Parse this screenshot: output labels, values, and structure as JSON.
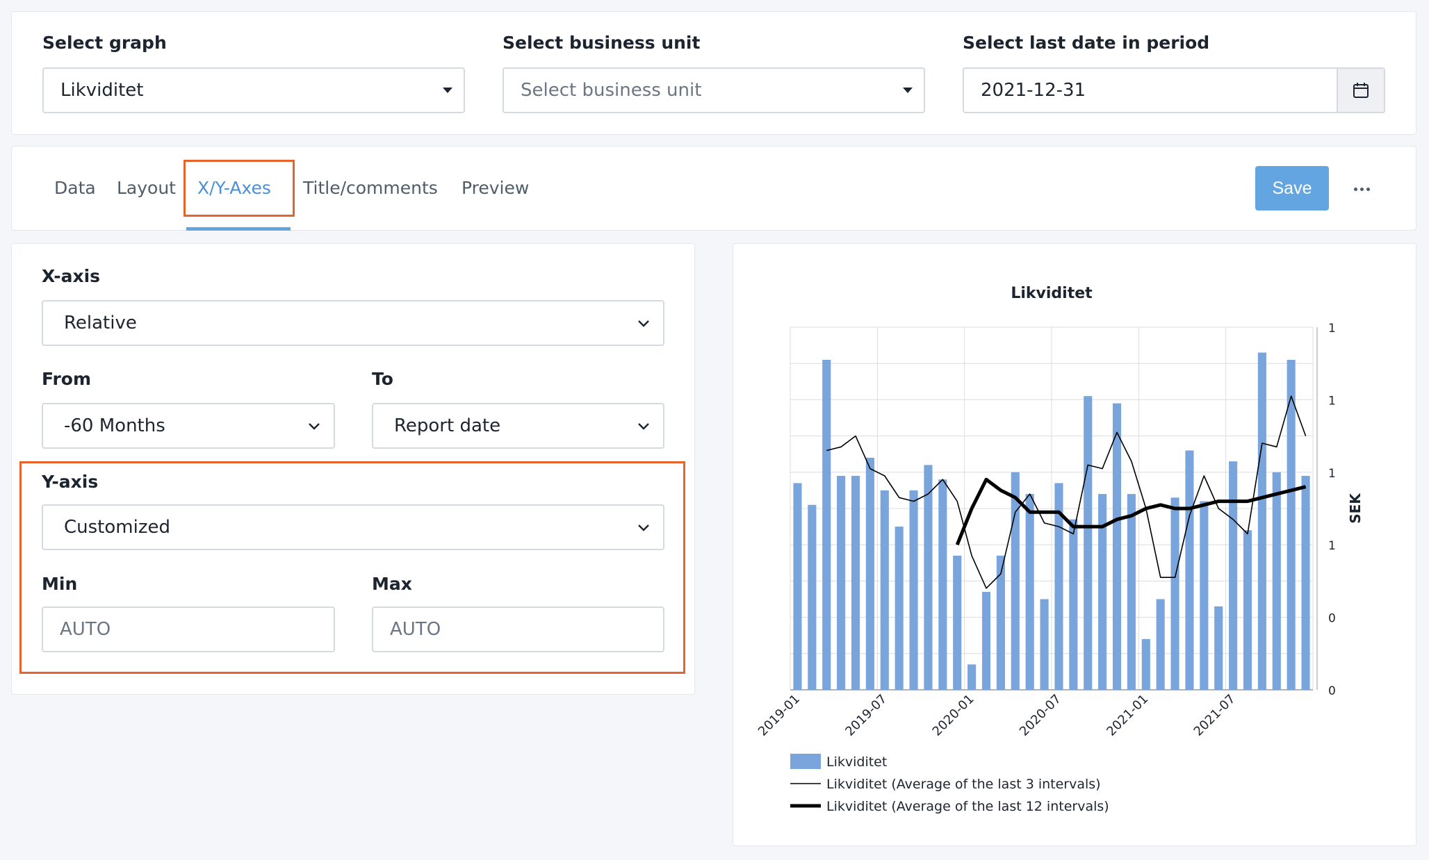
{
  "filters": {
    "graph": {
      "label": "Select graph",
      "value": "Likviditet"
    },
    "business_unit": {
      "label": "Select business unit",
      "placeholder": "Select business unit"
    },
    "last_date": {
      "label": "Select last date in period",
      "value": "2021-12-31"
    }
  },
  "tabs": [
    {
      "label": "Data",
      "active": false
    },
    {
      "label": "Layout",
      "active": false
    },
    {
      "label": "X/Y-Axes",
      "active": true
    },
    {
      "label": "Title/comments",
      "active": false
    },
    {
      "label": "Preview",
      "active": false
    }
  ],
  "toolbar": {
    "save_label": "Save",
    "more_icon": "ellipsis-icon"
  },
  "axes_form": {
    "x_axis": {
      "label": "X-axis",
      "value": "Relative"
    },
    "from": {
      "label": "From",
      "value": "-60 Months"
    },
    "to": {
      "label": "To",
      "value": "Report date"
    },
    "y_axis": {
      "label": "Y-axis",
      "value": "Customized"
    },
    "min": {
      "label": "Min",
      "placeholder": "AUTO"
    },
    "max": {
      "label": "Max",
      "placeholder": "AUTO"
    }
  },
  "colors": {
    "accent": "#4a90d9",
    "highlight": "#e8622c",
    "bar": "#7aa5dc",
    "save": "#62a5e0"
  },
  "chart_data": {
    "type": "bar",
    "title": "Likviditet",
    "ylabel": "SEK",
    "y_tick_labels": [
      "0",
      "0",
      "1",
      "1",
      "1",
      "1"
    ],
    "ylim": [
      0,
      1
    ],
    "x_tick_labels": [
      "2019-01",
      "2019-07",
      "2020-01",
      "2020-07",
      "2021-01",
      "2021-07"
    ],
    "categories": [
      "2019-01",
      "2019-02",
      "2019-03",
      "2019-04",
      "2019-05",
      "2019-06",
      "2019-07",
      "2019-08",
      "2019-09",
      "2019-10",
      "2019-11",
      "2019-12",
      "2020-01",
      "2020-02",
      "2020-03",
      "2020-04",
      "2020-05",
      "2020-06",
      "2020-07",
      "2020-08",
      "2020-09",
      "2020-10",
      "2020-11",
      "2020-12",
      "2021-01",
      "2021-02",
      "2021-03",
      "2021-04",
      "2021-05",
      "2021-06",
      "2021-07",
      "2021-08",
      "2021-09",
      "2021-10",
      "2021-11",
      "2021-12"
    ],
    "series": [
      {
        "name": "Likviditet",
        "kind": "bar",
        "values": [
          0.57,
          0.51,
          0.91,
          0.59,
          0.59,
          0.64,
          0.55,
          0.45,
          0.55,
          0.62,
          0.58,
          0.37,
          0.07,
          0.27,
          0.37,
          0.6,
          0.54,
          0.25,
          0.57,
          0.47,
          0.81,
          0.54,
          0.79,
          0.54,
          0.14,
          0.25,
          0.53,
          0.66,
          0.52,
          0.23,
          0.63,
          0.44,
          0.93,
          0.6,
          0.91,
          0.59
        ]
      },
      {
        "name": "Likviditet (Average of the last 3 intervals)",
        "kind": "line",
        "values": [
          null,
          null,
          0.66,
          0.67,
          0.7,
          0.61,
          0.59,
          0.53,
          0.52,
          0.54,
          0.58,
          0.52,
          0.37,
          0.28,
          0.32,
          0.49,
          0.54,
          0.46,
          0.45,
          0.43,
          0.62,
          0.61,
          0.71,
          0.63,
          0.5,
          0.31,
          0.31,
          0.48,
          0.59,
          0.5,
          0.47,
          0.43,
          0.68,
          0.67,
          0.81,
          0.7
        ]
      },
      {
        "name": "Likviditet (Average of the last 12 intervals)",
        "kind": "line",
        "values": [
          null,
          null,
          null,
          null,
          null,
          null,
          null,
          null,
          null,
          null,
          null,
          0.4,
          0.5,
          0.58,
          0.55,
          0.53,
          0.49,
          0.49,
          0.49,
          0.45,
          0.45,
          0.45,
          0.47,
          0.48,
          0.5,
          0.51,
          0.5,
          0.5,
          0.51,
          0.52,
          0.52,
          0.52,
          0.53,
          0.54,
          0.55,
          0.56
        ]
      }
    ],
    "legend": "bottom-left",
    "grid": true
  }
}
